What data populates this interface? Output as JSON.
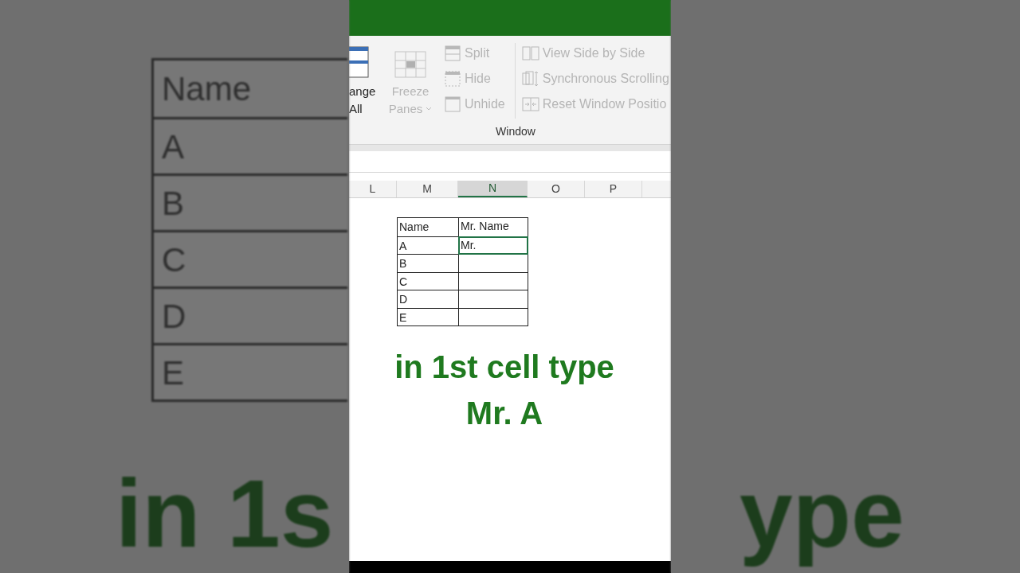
{
  "backdrop": {
    "table_cells": [
      "Name",
      "A",
      "B",
      "C",
      "D",
      "E"
    ],
    "caption_left": "in 1s",
    "caption_right": "ype"
  },
  "ribbon": {
    "big_buttons": [
      {
        "kind": "arrange",
        "lines": [
          "ange",
          "All"
        ],
        "disabled": false
      },
      {
        "kind": "freeze",
        "lines": [
          "Freeze",
          "Panes"
        ],
        "disabled": true
      }
    ],
    "small_buttons": [
      {
        "kind": "split",
        "label": "Split",
        "disabled": true
      },
      {
        "kind": "hide",
        "label": "Hide",
        "disabled": true
      },
      {
        "kind": "unhide",
        "label": "Unhide",
        "disabled": true
      },
      {
        "kind": "side",
        "label": "View Side by Side",
        "disabled": true
      },
      {
        "kind": "sync",
        "label": "Synchronous Scrolling",
        "disabled": true
      },
      {
        "kind": "reset",
        "label": "Reset Window Positio",
        "disabled": true
      }
    ],
    "group_label": "Window"
  },
  "columns": [
    {
      "label": "L",
      "selected": false
    },
    {
      "label": "M",
      "selected": false
    },
    {
      "label": "N",
      "selected": true
    },
    {
      "label": "O",
      "selected": false
    },
    {
      "label": "P",
      "selected": false
    }
  ],
  "table": {
    "rows": [
      {
        "name": "Name",
        "value": "Mr. Name",
        "selected": false
      },
      {
        "name": "A",
        "value": "Mr.",
        "selected": true
      },
      {
        "name": "B",
        "selected": false
      },
      {
        "name": "C",
        "selected": false
      },
      {
        "name": "D",
        "selected": false
      },
      {
        "name": "E",
        "selected": false
      }
    ]
  },
  "caption": [
    "in 1st cell type",
    "Mr. A"
  ]
}
